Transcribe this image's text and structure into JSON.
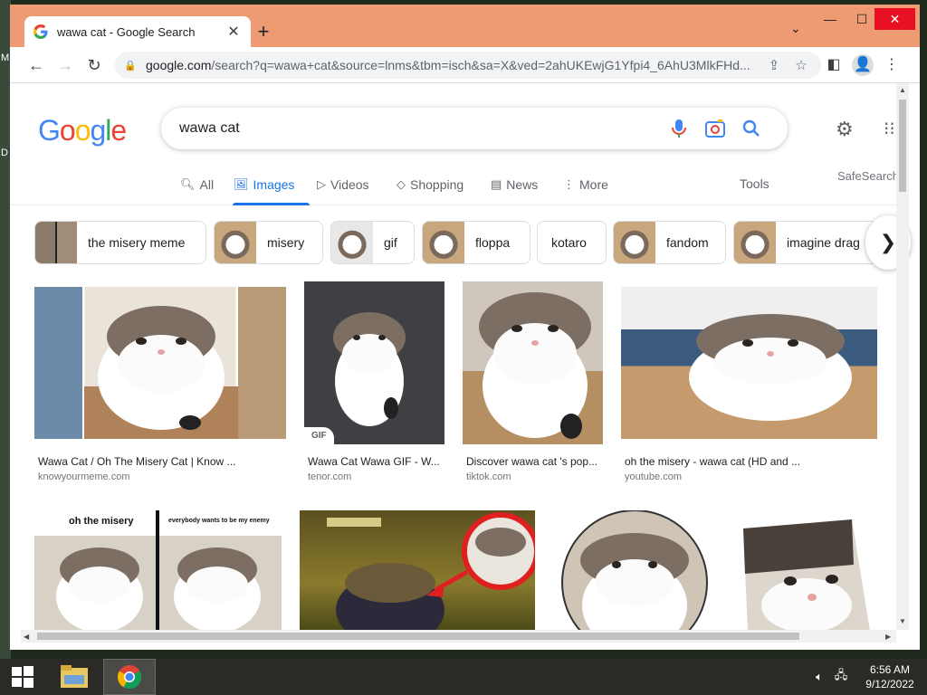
{
  "desktop": {
    "glyph1": "M",
    "glyph2": "D"
  },
  "browser": {
    "tab_title": "wawa cat - Google Search",
    "new_tab_label": "+",
    "url_host": "google.com",
    "url_path": "/search?q=wawa+cat&source=lnms&tbm=isch&sa=X&ved=2ahUKEwjG1Yfpi4_6AhU3MlkFHd..."
  },
  "google": {
    "logo": [
      "G",
      "o",
      "o",
      "g",
      "l",
      "e"
    ],
    "logo_colors": [
      "#4285f4",
      "#ea4335",
      "#fbbc05",
      "#4285f4",
      "#34a853",
      "#ea4335"
    ],
    "query": "wawa cat",
    "safesearch": "SafeSearch",
    "tabs": [
      {
        "label": "All",
        "icon": "search-icon"
      },
      {
        "label": "Images",
        "icon": "image-icon"
      },
      {
        "label": "Videos",
        "icon": "play-icon"
      },
      {
        "label": "Shopping",
        "icon": "tag-icon"
      },
      {
        "label": "News",
        "icon": "newspaper-icon"
      },
      {
        "label": "More",
        "icon": "more-vert-icon"
      }
    ],
    "tools": "Tools",
    "chips": [
      {
        "label": "the misery meme"
      },
      {
        "label": "misery"
      },
      {
        "label": "gif"
      },
      {
        "label": "floppa"
      },
      {
        "label": "kotaro"
      },
      {
        "label": "fandom"
      },
      {
        "label": "imagine drag"
      }
    ],
    "results": [
      {
        "title": "Wawa Cat / Oh The Misery Cat | Know ...",
        "source": "knowyourmeme.com"
      },
      {
        "title": "Wawa Cat Wawa GIF - W...",
        "source": "tenor.com",
        "badge": "GIF"
      },
      {
        "title": "Discover wawa cat 's pop...",
        "source": "tiktok.com"
      },
      {
        "title": "oh the misery - wawa cat (HD and ...",
        "source": "youtube.com"
      }
    ],
    "row2_captions": {
      "left": "oh the misery",
      "right": "everybody wants to be my enemy"
    }
  },
  "taskbar": {
    "time": "6:56 AM",
    "date": "9/12/2022"
  },
  "colors": {
    "accent": "#1a73e8",
    "frame": "#ee9a72",
    "taskbar": "#2b2a26"
  }
}
